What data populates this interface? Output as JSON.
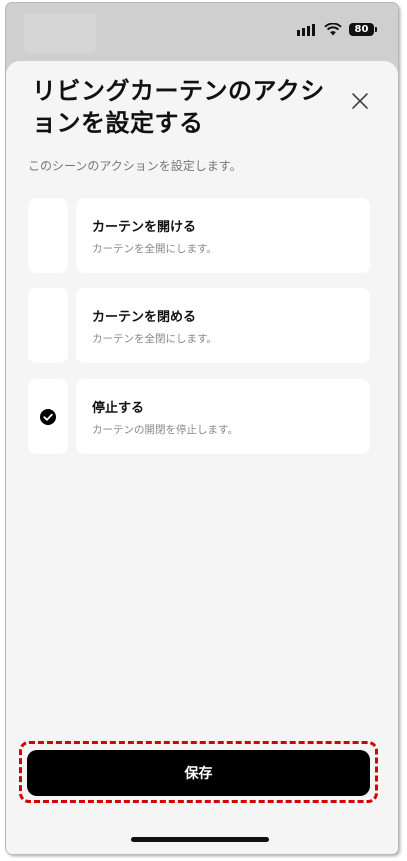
{
  "status_bar": {
    "battery_level": "80",
    "icons": [
      "signal-icon",
      "wifi-icon",
      "battery-icon"
    ]
  },
  "sheet": {
    "title": "リビングカーテンのアクションを設定する",
    "subtitle": "このシーンのアクションを設定します。",
    "close_icon": "close-icon"
  },
  "actions": [
    {
      "label": "カーテンを開ける",
      "description": "カーテンを全開にします。",
      "selected": false
    },
    {
      "label": "カーテンを閉める",
      "description": "カーテンを全閉にします。",
      "selected": false
    },
    {
      "label": "停止する",
      "description": "カーテンの開閉を停止します。",
      "selected": true
    }
  ],
  "footer": {
    "save_label": "保存"
  },
  "colors": {
    "primary_button": "#000000",
    "highlight": "#d40000",
    "sheet_background": "#f5f5f5"
  }
}
